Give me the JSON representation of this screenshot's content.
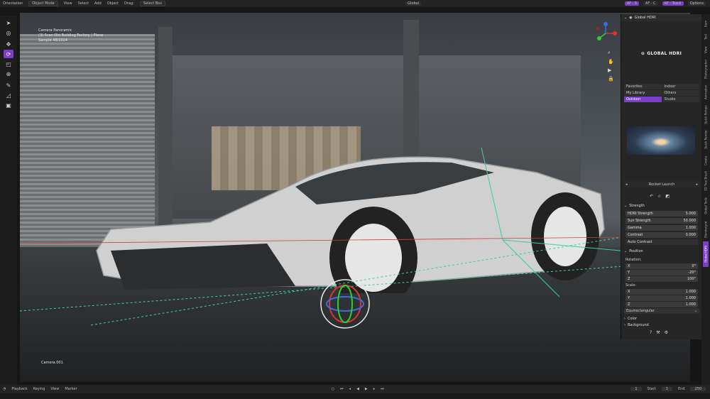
{
  "header": {
    "orientation": "Orientation",
    "mode": "Object Mode",
    "menus": [
      "View",
      "Select",
      "Add",
      "Object"
    ],
    "drag_label": "Drag:",
    "drag_value": "Select Box",
    "transform": "Global",
    "af_s": "AF · S",
    "af_c": "AF · C",
    "af_track": "AF · Track",
    "options": "Options"
  },
  "viewport": {
    "camera_title": "Camera Panoramic",
    "scene": "(3) Scan Old Building Factory | Plane",
    "sample": "Sample 48/1024",
    "camera_name": "Camera.001"
  },
  "panel": {
    "title": "Global HDRI",
    "logo_text": "GLOBAL HDRI",
    "categories": [
      {
        "label": "Favorites"
      },
      {
        "label": "Indoor"
      },
      {
        "label": "My Library"
      },
      {
        "label": "Others"
      },
      {
        "label": "Outdoor"
      },
      {
        "label": "Studio"
      }
    ],
    "hdri_name": "Rocket Launch",
    "strength_section": "Strength",
    "hdri_strength_label": "HDRI Strength",
    "hdri_strength_value": "5.000",
    "sun_strength_label": "Sun Strength",
    "sun_strength_value": "50.000",
    "gamma_label": "Gamma",
    "gamma_value": "1.000",
    "contrast_label": "Contrast",
    "contrast_value": "0.000",
    "auto_contrast": "Auto Contrast",
    "position_section": "Position",
    "rotation_label": "Rotation:",
    "rot_x_label": "X",
    "rot_x_value": "0°",
    "rot_y_label": "Y",
    "rot_y_value": "-20°",
    "rot_z_label": "Z",
    "rot_z_value": "100°",
    "scale_label": "Scale:",
    "scale_x_label": "X",
    "scale_x_value": "1.000",
    "scale_y_label": "Y",
    "scale_y_value": "1.000",
    "scale_z_label": "Z",
    "scale_z_value": "1.000",
    "projection": "Equirectangular",
    "color_section": "Color",
    "background_section": "Background"
  },
  "side_tabs": [
    "Item",
    "Tool",
    "View",
    "Photographer",
    "Animation",
    "Quick Retopo",
    "Quick Render",
    "Create",
    "3D Tree Brush",
    "Global Tools",
    "Blendergrid",
    "Global HDRI"
  ],
  "timeline": {
    "playback": "Playback",
    "keying": "Keying",
    "view": "View",
    "marker": "Marker",
    "current_frame": "1",
    "start_label": "Start",
    "start_value": "1",
    "end_label": "End",
    "end_value": "250"
  },
  "colors": {
    "accent": "#7a3fc4",
    "panel": "#262626",
    "bg": "#161616"
  }
}
